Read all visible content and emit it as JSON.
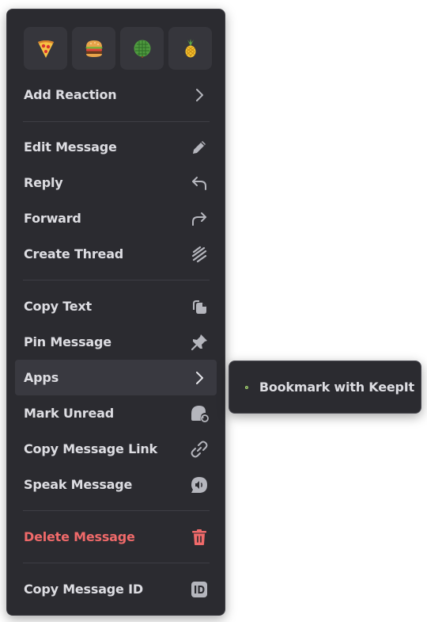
{
  "quick_reactions": [
    {
      "icon": "pizza-emoji"
    },
    {
      "icon": "hamburger-emoji"
    },
    {
      "icon": "melon-emoji"
    },
    {
      "icon": "pineapple-emoji"
    }
  ],
  "menu": {
    "add_reaction": "Add Reaction",
    "edit_message": "Edit Message",
    "reply": "Reply",
    "forward": "Forward",
    "create_thread": "Create Thread",
    "copy_text": "Copy Text",
    "pin_message": "Pin Message",
    "apps": "Apps",
    "mark_unread": "Mark Unread",
    "copy_message_link": "Copy Message Link",
    "speak_message": "Speak Message",
    "delete_message": "Delete Message",
    "copy_message_id": "Copy Message ID"
  },
  "apps_submenu": {
    "items": [
      {
        "label": "Bookmark with KeepIt",
        "icon": "keepit-app-icon"
      }
    ]
  },
  "colors": {
    "menu_bg": "#2b2b30",
    "text": "#dddde2",
    "icon": "#b5b6bd",
    "danger": "#f06a6a",
    "active_bg": "#393940",
    "app_icon": "#b9f27a"
  }
}
